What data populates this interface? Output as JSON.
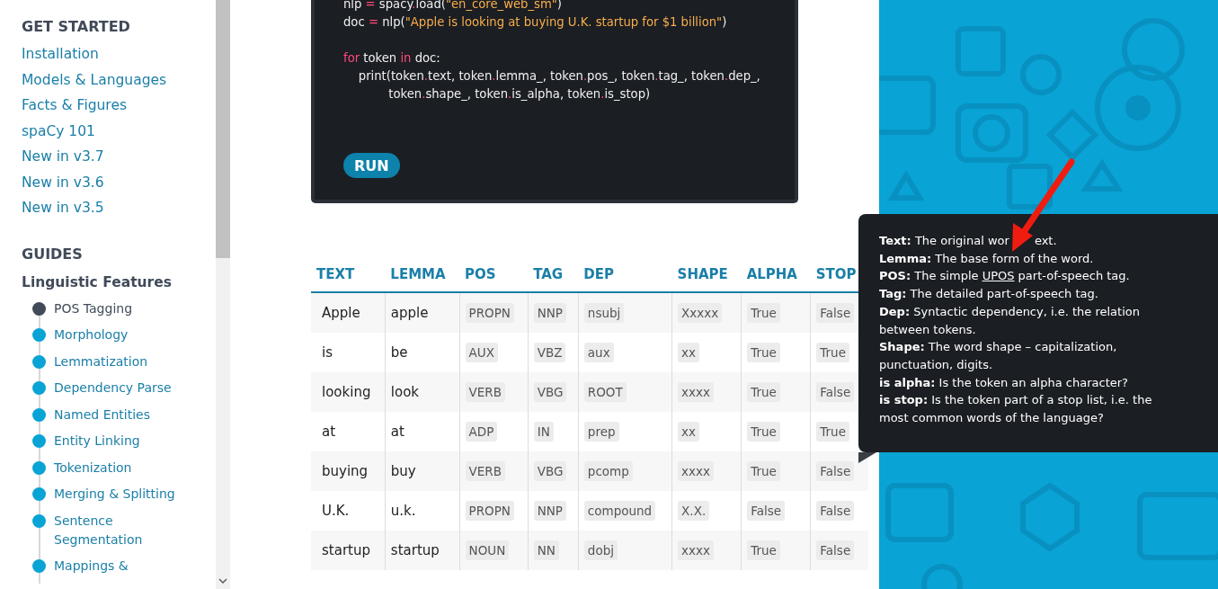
{
  "sidebar": {
    "sections": [
      {
        "title": "GET STARTED",
        "items": [
          {
            "label": "Installation"
          },
          {
            "label": "Models & Languages"
          },
          {
            "label": "Facts & Figures"
          },
          {
            "label": "spaCy 101"
          },
          {
            "label": "New in v3.7"
          },
          {
            "label": "New in v3.6"
          },
          {
            "label": "New in v3.5"
          }
        ]
      },
      {
        "title": "GUIDES",
        "subtitle": "Linguistic Features",
        "subitems": [
          {
            "label": "POS Tagging",
            "selected": true
          },
          {
            "label": "Morphology",
            "selected": false
          },
          {
            "label": "Lemmatization",
            "selected": false
          },
          {
            "label": "Dependency Parse",
            "selected": false
          },
          {
            "label": "Named Entities",
            "selected": false
          },
          {
            "label": "Entity Linking",
            "selected": false
          },
          {
            "label": "Tokenization",
            "selected": false
          },
          {
            "label": "Merging & Splitting",
            "selected": false
          },
          {
            "label": "Sentence Segmentation",
            "selected": false
          },
          {
            "label": "Mappings &",
            "selected": false
          }
        ]
      }
    ]
  },
  "code": {
    "blocks": [
      [
        "nlp = spacy.load(\"en_core_web_sm\")",
        "doc = nlp(\"Apple is looking at buying U.K. startup for $1 billion\")"
      ],
      [
        "for token in doc:",
        "    print(token.text, token.lemma_, token.pos_, token.tag_, token.dep_,",
        "            token.shape_, token.is_alpha, token.is_stop)"
      ]
    ],
    "button": "RUN"
  },
  "table": {
    "columns": [
      {
        "label": "TEXT",
        "kind": "plain"
      },
      {
        "label": "LEMMA",
        "kind": "plain"
      },
      {
        "label": "POS",
        "kind": "code"
      },
      {
        "label": "TAG",
        "kind": "code"
      },
      {
        "label": "DEP",
        "kind": "code"
      },
      {
        "label": "SHAPE",
        "kind": "code"
      },
      {
        "label": "ALPHA",
        "kind": "code"
      },
      {
        "label": "STOP",
        "kind": "code"
      }
    ],
    "rows": [
      [
        "Apple",
        "apple",
        "PROPN",
        "NNP",
        "nsubj",
        "Xxxxx",
        "True",
        "False"
      ],
      [
        "is",
        "be",
        "AUX",
        "VBZ",
        "aux",
        "xx",
        "True",
        "True"
      ],
      [
        "looking",
        "look",
        "VERB",
        "VBG",
        "ROOT",
        "xxxx",
        "True",
        "False"
      ],
      [
        "at",
        "at",
        "ADP",
        "IN",
        "prep",
        "xx",
        "True",
        "True"
      ],
      [
        "buying",
        "buy",
        "VERB",
        "VBG",
        "pcomp",
        "xxxx",
        "True",
        "False"
      ],
      [
        "U.K.",
        "u.k.",
        "PROPN",
        "NNP",
        "compound",
        "X.X.",
        "False",
        "False"
      ],
      [
        "startup",
        "startup",
        "NOUN",
        "NN",
        "dobj",
        "xxxx",
        "True",
        "False"
      ]
    ]
  },
  "tooltip": {
    "entries": [
      {
        "label": "Text:",
        "text": "The original wor",
        "covered_tail": "ext."
      },
      {
        "label": "Lemma:",
        "text": "The base form of the word."
      },
      {
        "label": "POS:",
        "text": "The simple",
        "link": "UPOS",
        "after": "part-of-speech tag."
      },
      {
        "label": "Tag:",
        "text": "The detailed part-of-speech tag."
      },
      {
        "label": "Dep:",
        "text": "Syntactic dependency, i.e. the relation between tokens."
      },
      {
        "label": "Shape:",
        "text": "The word shape – capitalization, punctuation, digits."
      },
      {
        "label": "is alpha:",
        "text": "Is the token an alpha character?"
      },
      {
        "label": "is stop:",
        "text": "Is the token part of a stop list, i.e. the most common words of the language?"
      }
    ]
  }
}
